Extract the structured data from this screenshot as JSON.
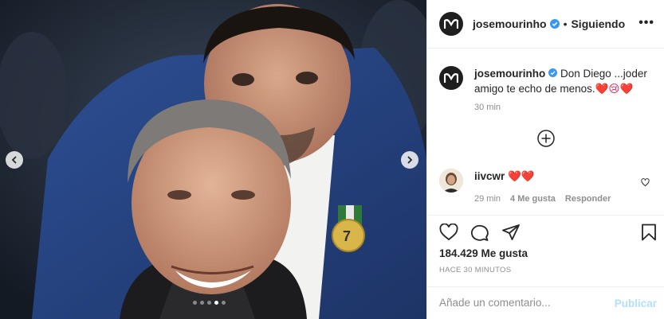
{
  "post": {
    "photo_alt": "",
    "carousel": {
      "dot_count": 5,
      "active_index": 3
    }
  },
  "header": {
    "username": "josemourinho",
    "separator": "•",
    "follow_state": "Siguiendo",
    "more_label": "•••"
  },
  "caption": {
    "username": "josemourinho",
    "text": " Don Diego ...joder amigo te echo de menos.",
    "emoji": "❤️😢❤️",
    "time": "30 min"
  },
  "comment": {
    "username": "iivcwr",
    "text": " ❤️❤️",
    "time": "29 min",
    "likes": "4 Me gusta",
    "reply": "Responder"
  },
  "actions": {
    "likes": "184.429 Me gusta",
    "posted": "HACE 30 MINUTOS"
  },
  "add_comment": {
    "placeholder": "Añade un comentario...",
    "publish": "Publicar"
  },
  "colors": {
    "verified": "#3897f0",
    "heart": "#e0245e",
    "publish_disabled": "#b2dffc"
  }
}
